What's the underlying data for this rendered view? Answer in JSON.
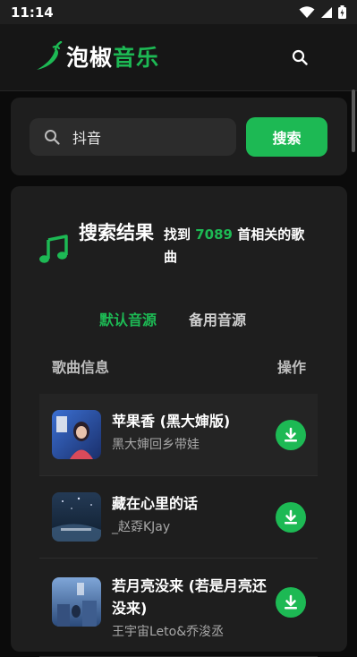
{
  "status_bar": {
    "time": "11:14"
  },
  "header": {
    "brand_white": "泡椒",
    "brand_green": "音乐"
  },
  "search": {
    "value": "抖音",
    "button": "搜索"
  },
  "results": {
    "title": "搜索结果",
    "count_prefix": "找到 ",
    "count": "7089",
    "count_suffix": " 首相关的歌曲",
    "tabs": [
      {
        "label": "默认音源",
        "active": true
      },
      {
        "label": "备用音源",
        "active": false
      }
    ],
    "column_info": "歌曲信息",
    "column_action": "操作",
    "songs": [
      {
        "title": "苹果香 (黑大婶版)",
        "artist": "黑大婶回乡带娃"
      },
      {
        "title": "藏在心里的话",
        "artist": "_赵孬KJay"
      },
      {
        "title": "若月亮没来 (若是月亮还没来)",
        "artist": "王宇宙Leto&乔浚丞"
      }
    ]
  },
  "colors": {
    "accent": "#1db954",
    "background": "#0b0b0b",
    "card": "#1e1e1e"
  },
  "icons": [
    "chili-pepper-icon",
    "search-icon",
    "music-note-icon",
    "download-icon",
    "wifi-icon",
    "signal-icon",
    "battery-icon"
  ]
}
